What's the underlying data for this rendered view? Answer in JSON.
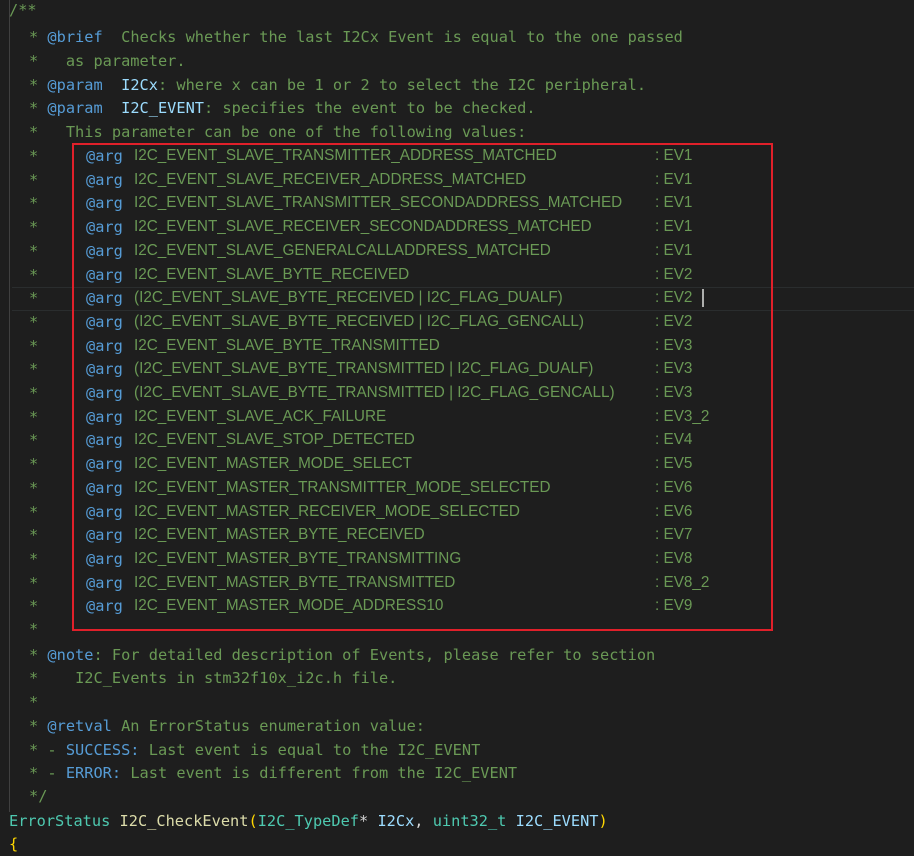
{
  "header": {
    "open_comment": "/**",
    "brief_tag": "@brief",
    "brief_text": "  Checks whether the last I2Cx Event is equal to the one passed",
    "brief_cont": "as parameter.",
    "param1_tag": "@param",
    "param1_name": "I2Cx",
    "param1_text": ": where x can be 1 or 2 to select the I2C peripheral.",
    "param2_tag": "@param",
    "param2_name": "I2C_EVENT",
    "param2_text": ": specifies the event to be checked.",
    "param2_cont": "This parameter can be one of the following values:"
  },
  "args": {
    "tag": "@arg",
    "items": [
      {
        "name": "I2C_EVENT_SLAVE_TRANSMITTER_ADDRESS_MATCHED",
        "ev": ": EV1"
      },
      {
        "name": "I2C_EVENT_SLAVE_RECEIVER_ADDRESS_MATCHED",
        "ev": ": EV1"
      },
      {
        "name": "I2C_EVENT_SLAVE_TRANSMITTER_SECONDADDRESS_MATCHED",
        "ev": ": EV1"
      },
      {
        "name": "I2C_EVENT_SLAVE_RECEIVER_SECONDADDRESS_MATCHED",
        "ev": ": EV1"
      },
      {
        "name": "I2C_EVENT_SLAVE_GENERALCALLADDRESS_MATCHED",
        "ev": ": EV1"
      },
      {
        "name": "I2C_EVENT_SLAVE_BYTE_RECEIVED",
        "ev": ": EV2"
      },
      {
        "name": "(I2C_EVENT_SLAVE_BYTE_RECEIVED | I2C_FLAG_DUALF)",
        "ev": ": EV2"
      },
      {
        "name": "(I2C_EVENT_SLAVE_BYTE_RECEIVED | I2C_FLAG_GENCALL)",
        "ev": ": EV2"
      },
      {
        "name": "I2C_EVENT_SLAVE_BYTE_TRANSMITTED",
        "ev": ": EV3"
      },
      {
        "name": "(I2C_EVENT_SLAVE_BYTE_TRANSMITTED | I2C_FLAG_DUALF)",
        "ev": ": EV3"
      },
      {
        "name": "(I2C_EVENT_SLAVE_BYTE_TRANSMITTED | I2C_FLAG_GENCALL)",
        "ev": ": EV3"
      },
      {
        "name": "I2C_EVENT_SLAVE_ACK_FAILURE",
        "ev": ": EV3_2"
      },
      {
        "name": "I2C_EVENT_SLAVE_STOP_DETECTED",
        "ev": ": EV4"
      },
      {
        "name": "I2C_EVENT_MASTER_MODE_SELECT",
        "ev": ": EV5"
      },
      {
        "name": "I2C_EVENT_MASTER_TRANSMITTER_MODE_SELECTED",
        "ev": ": EV6"
      },
      {
        "name": "I2C_EVENT_MASTER_RECEIVER_MODE_SELECTED",
        "ev": ": EV6"
      },
      {
        "name": "I2C_EVENT_MASTER_BYTE_RECEIVED",
        "ev": ": EV7"
      },
      {
        "name": "I2C_EVENT_MASTER_BYTE_TRANSMITTING",
        "ev": ": EV8"
      },
      {
        "name": "I2C_EVENT_MASTER_BYTE_TRANSMITTED",
        "ev": ": EV8_2"
      },
      {
        "name": "I2C_EVENT_MASTER_MODE_ADDRESS10",
        "ev": ": EV9"
      }
    ]
  },
  "footer": {
    "note_tag": "@note",
    "note_text": ": For detailed description of Events, please refer to section",
    "note_cont": "I2C_Events in stm32f10x_i2c.h file.",
    "retval_tag": "@retval",
    "retval_text": " An ErrorStatus enumeration value:",
    "success_prefix": "* - ",
    "success_label": "SUCCESS:",
    "success_text": " Last event is equal to the I2C_EVENT",
    "error_prefix": "* - ",
    "error_label": "ERROR:",
    "error_text": " Last event is different from the I2C_EVENT",
    "close_comment": "*/"
  },
  "signature": {
    "return_type": "ErrorStatus",
    "func_name": "I2C_CheckEvent",
    "open_paren": "(",
    "param1_type": "I2C_TypeDef",
    "star": "*",
    "param1_name": "I2Cx",
    "comma": ",",
    "param2_type": "uint32_t",
    "param2_name": "I2C_EVENT",
    "close_paren": ")",
    "open_brace": "{"
  },
  "colors": {
    "background": "#1e1e1e",
    "comment": "#6a9955",
    "doc_tag": "#569cd6",
    "type": "#4ec9b0",
    "function": "#dcdcaa",
    "variable": "#9cdcfe",
    "highlight_box": "#e0202a"
  }
}
